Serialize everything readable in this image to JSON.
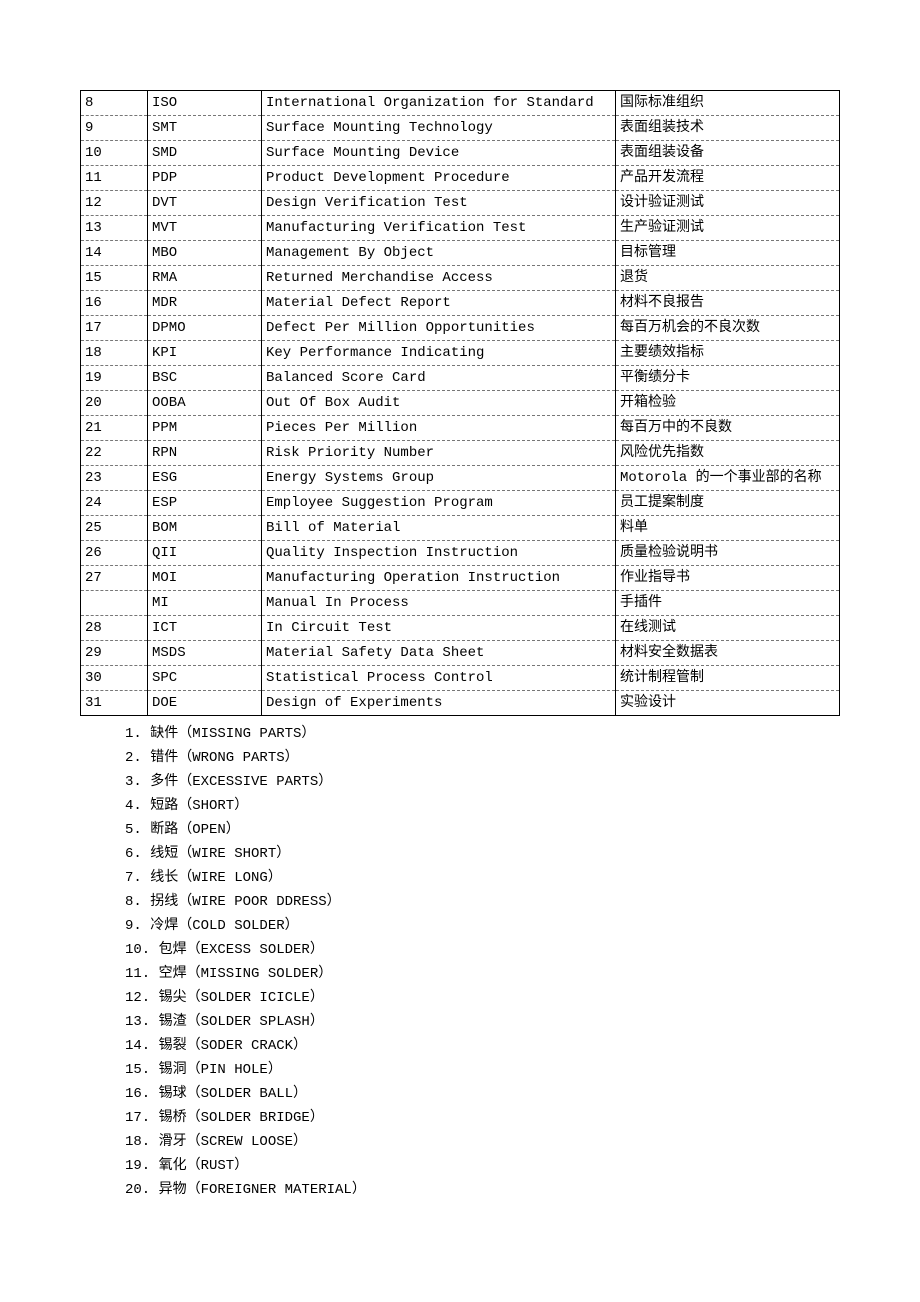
{
  "table_rows": [
    {
      "c1": "8",
      "c2": "ISO",
      "c3": "International Organization for Standard",
      "c4": "国际标准组织"
    },
    {
      "c1": "9",
      "c2": "SMT",
      "c3": "Surface Mounting Technology",
      "c4": "表面组装技术"
    },
    {
      "c1": "10",
      "c2": "SMD",
      "c3": "Surface Mounting Device",
      "c4": "表面组装设备"
    },
    {
      "c1": "11",
      "c2": "PDP",
      "c3": "Product Development Procedure",
      "c4": "产品开发流程"
    },
    {
      "c1": "12",
      "c2": "DVT",
      "c3": "Design Verification Test",
      "c4": "设计验证测试"
    },
    {
      "c1": "13",
      "c2": "MVT",
      "c3": "Manufacturing Verification Test",
      "c4": "生产验证测试"
    },
    {
      "c1": "14",
      "c2": "MBO",
      "c3": "Management By Object",
      "c4": "目标管理"
    },
    {
      "c1": "15",
      "c2": "RMA",
      "c3": "Returned Merchandise Access",
      "c4": "退货"
    },
    {
      "c1": "16",
      "c2": "MDR",
      "c3": "Material Defect Report",
      "c4": "材料不良报告"
    },
    {
      "c1": "17",
      "c2": "DPMO",
      "c3": "Defect Per Million Opportunities",
      "c4": "每百万机会的不良次数"
    },
    {
      "c1": "18",
      "c2": "KPI",
      "c3": "Key Performance Indicating",
      "c4": "主要绩效指标"
    },
    {
      "c1": "19",
      "c2": "BSC",
      "c3": "Balanced Score  Card",
      "c4": "平衡绩分卡"
    },
    {
      "c1": "20",
      "c2": "OOBA",
      "c3": "Out Of Box Audit",
      "c4": "开箱检验"
    },
    {
      "c1": "21",
      "c2": "PPM",
      "c3": "Pieces Per Million",
      "c4": "每百万中的不良数"
    },
    {
      "c1": "22",
      "c2": "RPN",
      "c3": "Risk Priority Number",
      "c4": "风险优先指数"
    },
    {
      "c1": "23",
      "c2": "ESG",
      "c3": "Energy Systems Group",
      "c4": "Motorola 的一个事业部的名称"
    },
    {
      "c1": "24",
      "c2": "ESP",
      "c3": "Employee Suggestion Program",
      "c4": "员工提案制度"
    },
    {
      "c1": "25",
      "c2": "BOM",
      "c3": "Bill of Material",
      "c4": "料单"
    },
    {
      "c1": "26",
      "c2": "QII",
      "c3": "Quality Inspection Instruction",
      "c4": "质量检验说明书"
    },
    {
      "c1": "27",
      "c2": "MOI",
      "c3": "Manufacturing Operation Instruction",
      "c4": "作业指导书"
    },
    {
      "c1": "",
      "c2": "MI",
      "c3": "Manual In Process",
      "c4": "手插件"
    },
    {
      "c1": "28",
      "c2": "ICT",
      "c3": "In Circuit Test",
      "c4": "在线测试"
    },
    {
      "c1": "29",
      "c2": "MSDS",
      "c3": "Material Safety Data Sheet",
      "c4": "材料安全数据表"
    },
    {
      "c1": "30",
      "c2": "SPC",
      "c3": "Statistical Process Control",
      "c4": "统计制程管制"
    },
    {
      "c1": "31",
      "c2": "DOE",
      "c3": "Design of Experiments",
      "c4": "实验设计"
    }
  ],
  "defects": [
    "1. 缺件（MISSING PARTS）",
    "2. 错件（WRONG PARTS）",
    "3. 多件（EXCESSIVE PARTS）",
    "4. 短路（SHORT）",
    "5. 断路（OPEN）",
    "6. 线短（WIRE SHORT）",
    "7. 线长（WIRE LONG）",
    "8. 拐线（WIRE POOR DDRESS）",
    "9. 冷焊（COLD SOLDER）",
    "10. 包焊（EXCESS SOLDER）",
    "11. 空焊（MISSING SOLDER）",
    "12. 锡尖（SOLDER ICICLE）",
    "13. 锡渣（SOLDER SPLASH）",
    "14. 锡裂（SODER CRACK）",
    "15. 锡洞（PIN HOLE）",
    "16. 锡球（SOLDER BALL）",
    "17. 锡桥（SOLDER BRIDGE）",
    "18. 滑牙（SCREW LOOSE）",
    "19. 氧化（RUST）",
    "20. 异物（FOREIGNER MATERIAL）"
  ]
}
